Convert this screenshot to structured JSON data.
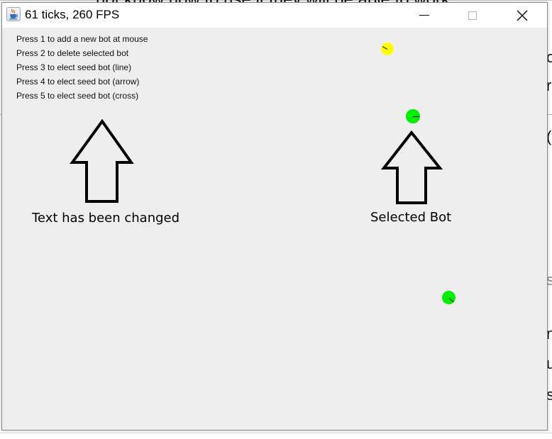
{
  "window": {
    "title": "61 ticks, 260 FPS"
  },
  "instructions": [
    "Press 1 to add a new bot at mouse",
    "Press 2 to delete selected bot",
    "Press 3 to elect seed bot (line)",
    "Press 4 to elect seed bot (arrow)",
    "Press 5 to elect seed bot (cross)"
  ],
  "annotations": {
    "left": "Text has been changed",
    "right": "Selected Bot"
  },
  "bots": [
    {
      "color": "#ffff00",
      "heading_deg": 210
    },
    {
      "color": "#00ee00",
      "heading_deg": 0
    },
    {
      "color": "#00ee00",
      "heading_deg": 40
    }
  ],
  "icons": {
    "app": "java-coffee-cup-icon",
    "minimize": "minimize-icon",
    "maximize": "maximize-icon",
    "close": "close-icon",
    "annotation_arrows": "up-arrow-icon"
  },
  "background_fragments": {
    "top": "not know how to use it they will be able to work",
    "right": [
      "o",
      "r",
      "(",
      "s",
      "n",
      "u",
      "s"
    ]
  }
}
